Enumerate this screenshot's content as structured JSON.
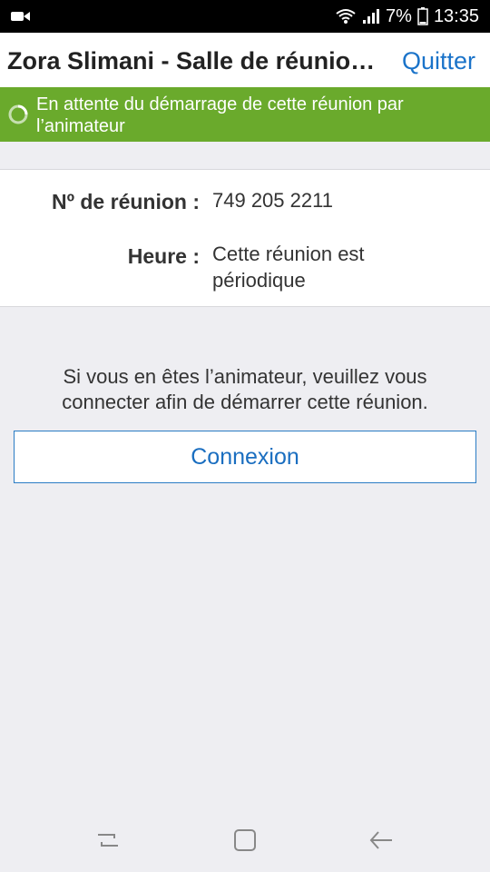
{
  "status_bar": {
    "battery": "7%",
    "time": "13:35"
  },
  "header": {
    "title": "Zora Slimani - Salle de réunion personnelle",
    "quit_label": "Quitter"
  },
  "banner": {
    "message": "En attente du démarrage de cette réunion par l’animateur"
  },
  "meeting_info": {
    "id_label": "Nº de réunion :",
    "id_value": "749 205 2211",
    "time_label": "Heure :",
    "time_value": "Cette réunion est périodique"
  },
  "host_hint": "Si vous en êtes l’animateur, veuillez vous connecter afin de démarrer cette réunion.",
  "connect_label": "Connexion",
  "icons": {
    "camera": "video-camera-icon",
    "wifi": "wifi-icon",
    "signal": "signal-icon",
    "battery": "battery-icon",
    "spinner": "loading-spinner-icon",
    "recents": "recents-icon",
    "home": "home-icon",
    "back": "back-icon"
  },
  "colors": {
    "accent": "#1a73c9",
    "banner": "#6aaa2c"
  }
}
